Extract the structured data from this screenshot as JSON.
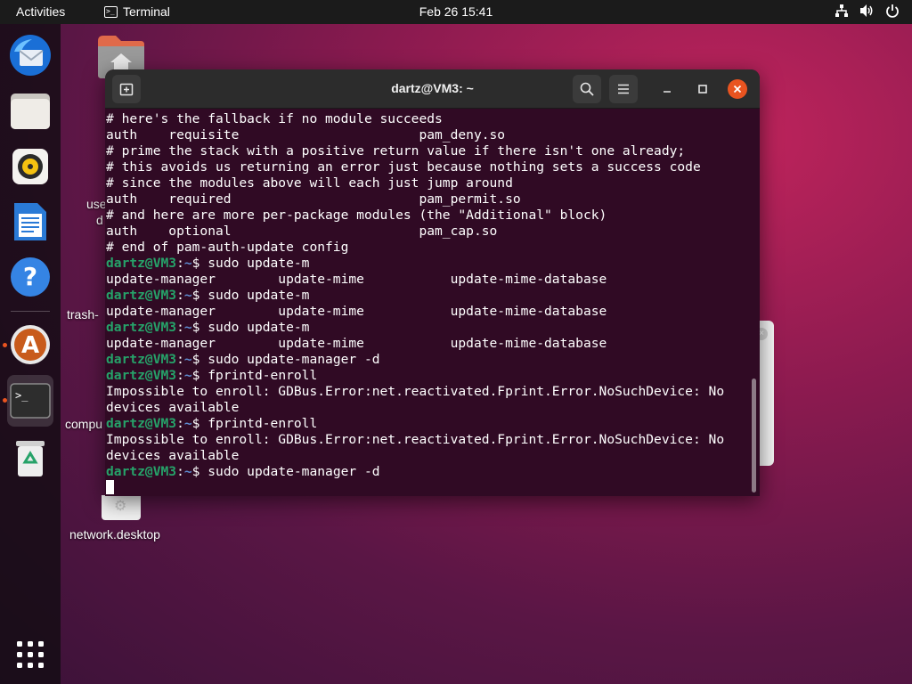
{
  "topbar": {
    "activities": "Activities",
    "app_name": "Terminal",
    "clock": "Feb 26  15:41"
  },
  "desktop": {
    "items": [
      {
        "label": "use"
      },
      {
        "label": "d"
      },
      {
        "label": "trash-"
      },
      {
        "label": "compu"
      },
      {
        "label": "network.desktop"
      }
    ]
  },
  "terminal": {
    "title": "dartz@VM3: ~",
    "lines": [
      "# here's the fallback if no module succeeds",
      "auth    requisite                       pam_deny.so",
      "# prime the stack with a positive return value if there isn't one already;",
      "# this avoids us returning an error just because nothing sets a success code",
      "# since the modules above will each just jump around",
      "auth    required                        pam_permit.so",
      "# and here are more per-package modules (the \"Additional\" block)",
      "auth    optional                        pam_cap.so",
      "# end of pam-auth-update config",
      {
        "user": "dartz@VM3",
        "path": "~",
        "cmd": "$ sudo update-m"
      },
      "update-manager        update-mime           update-mime-database",
      {
        "user": "dartz@VM3",
        "path": "~",
        "cmd": "$ sudo update-m"
      },
      "update-manager        update-mime           update-mime-database",
      {
        "user": "dartz@VM3",
        "path": "~",
        "cmd": "$ sudo update-m"
      },
      "update-manager        update-mime           update-mime-database",
      {
        "user": "dartz@VM3",
        "path": "~",
        "cmd": "$ sudo update-manager -d"
      },
      {
        "user": "dartz@VM3",
        "path": "~",
        "cmd": "$ fprintd-enroll"
      },
      "Impossible to enroll: GDBus.Error:net.reactivated.Fprint.Error.NoSuchDevice: No",
      "devices available",
      {
        "user": "dartz@VM3",
        "path": "~",
        "cmd": "$ fprintd-enroll"
      },
      "Impossible to enroll: GDBus.Error:net.reactivated.Fprint.Error.NoSuchDevice: No",
      "devices available",
      {
        "user": "dartz@VM3",
        "path": "~",
        "cmd": "$ sudo update-manager -d"
      }
    ]
  },
  "dock": {
    "apps": [
      {
        "icon": "thunderbird-icon"
      },
      {
        "icon": "files-icon"
      },
      {
        "icon": "rhythmbox-icon"
      },
      {
        "icon": "libreoffice-writer-icon"
      },
      {
        "icon": "help-icon"
      },
      {
        "icon": "software-icon"
      },
      {
        "icon": "terminal-icon"
      },
      {
        "icon": "trash-icon"
      }
    ]
  },
  "colors": {
    "terminal_bg": "#300a24",
    "prompt_user": "#26a269",
    "prompt_path": "#5e8cd0",
    "accent": "#e95420"
  }
}
